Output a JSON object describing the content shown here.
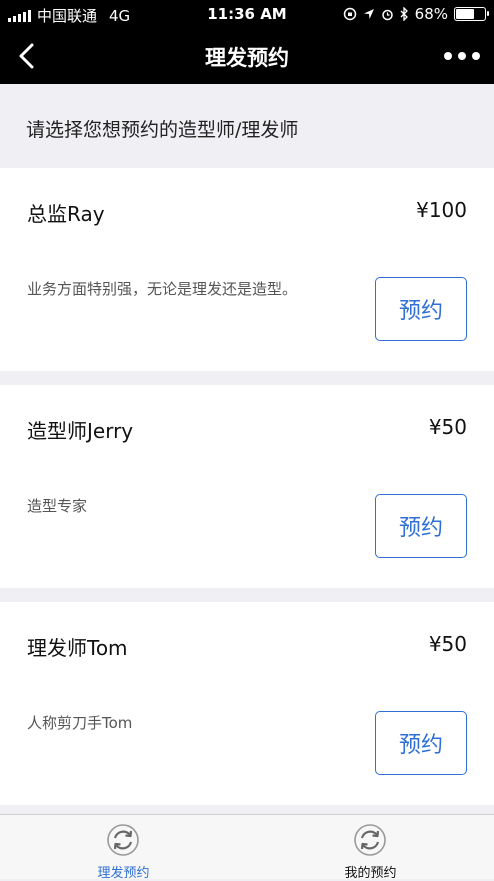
{
  "status_bar": {
    "carrier": "中国联通",
    "network": "4G",
    "time": "11:36 AM",
    "battery": "68%",
    "battery_level": 0.68
  },
  "nav": {
    "title": "理发预约",
    "back_icon": "chevron-left-icon",
    "more_icon": "more-dots-icon"
  },
  "heading": "请选择您想预约的造型师/理发师",
  "stylists": [
    {
      "name": "总监Ray",
      "price": "¥100",
      "description": "业务方面特别强，无论是理发还是造型。",
      "button": "预约"
    },
    {
      "name": "造型师Jerry",
      "price": "¥50",
      "description": "造型专家",
      "button": "预约"
    },
    {
      "name": "理发师Tom",
      "price": "¥50",
      "description": "人称剪刀手Tom",
      "button": "预约"
    }
  ],
  "tabs": [
    {
      "label": "理发预约",
      "icon": "refresh-cycle-icon",
      "active": true
    },
    {
      "label": "我的预约",
      "icon": "refresh-cycle-icon",
      "active": false
    }
  ],
  "colors": {
    "accent": "#2f6fd6",
    "nav_background": "#000000",
    "page_background": "#efeff4"
  }
}
